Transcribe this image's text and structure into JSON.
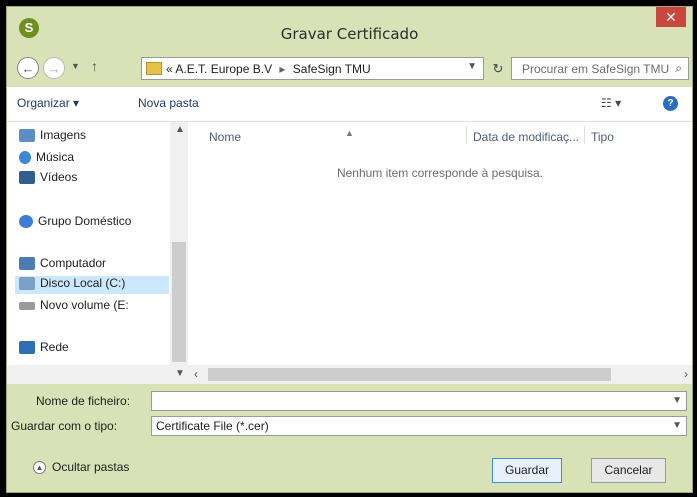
{
  "window": {
    "title": "Gravar Certificado",
    "app_icon": "safesign-icon",
    "close_label": "✕"
  },
  "address": {
    "crumb_prefix": "«",
    "crumbs": [
      "A.E.T. Europe B.V",
      "SafeSign TMU"
    ],
    "search_placeholder": "Procurar em SafeSign TMU"
  },
  "toolbar": {
    "organize_label": "Organizar ▾",
    "new_folder_label": "Nova pasta"
  },
  "nav": {
    "items": [
      {
        "label": "Imagens",
        "icon": "pictures-icon"
      },
      {
        "label": "Música",
        "icon": "music-icon"
      },
      {
        "label": "Vídeos",
        "icon": "videos-icon"
      },
      {
        "label": "Grupo Doméstico",
        "icon": "homegroup-icon"
      },
      {
        "label": "Computador",
        "icon": "computer-icon"
      },
      {
        "label": "Disco Local (C:)",
        "icon": "drive-icon",
        "selected": true
      },
      {
        "label": "Novo volume (E:",
        "icon": "drive-icon"
      },
      {
        "label": "Rede",
        "icon": "network-icon"
      }
    ]
  },
  "list": {
    "columns": [
      "Nome",
      "Data de modificaç...",
      "Tipo"
    ],
    "empty_message": "Nenhum item corresponde à pesquisa."
  },
  "form": {
    "filename_label": "Nome de ficheiro:",
    "filename_value": "",
    "type_label": "Guardar com o tipo:",
    "type_value": "Certificate File (*.cer)"
  },
  "footer": {
    "hide_folders_label": "Ocultar pastas",
    "save_label": "Guardar",
    "cancel_label": "Cancelar"
  },
  "colors": {
    "window_frame": "#d8e2b6",
    "close_button": "#c9473f",
    "selection": "#cce8ff"
  }
}
